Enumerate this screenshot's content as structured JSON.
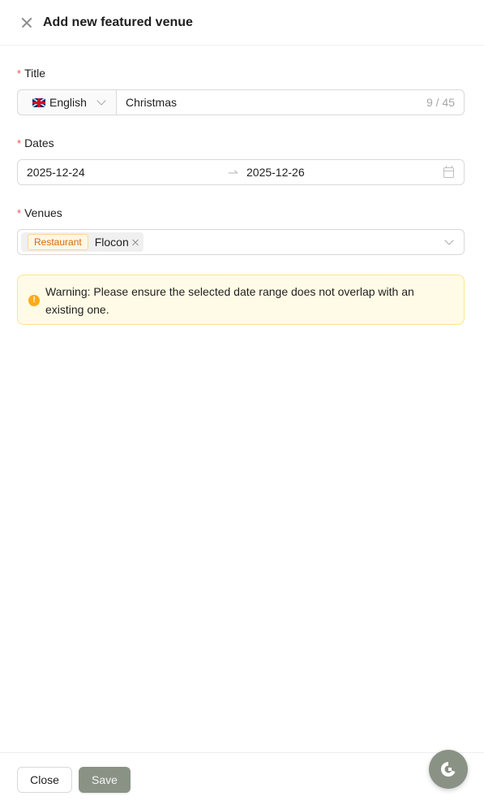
{
  "header": {
    "title": "Add new featured venue"
  },
  "form": {
    "title": {
      "label": "Title",
      "required_mark": "*",
      "language": "English",
      "value": "Christmas",
      "counter": "9 / 45"
    },
    "dates": {
      "label": "Dates",
      "required_mark": "*",
      "start": "2025-12-24",
      "end": "2025-12-26"
    },
    "venues": {
      "label": "Venues",
      "required_mark": "*",
      "selected": [
        {
          "category": "Restaurant",
          "name": "Flocon"
        }
      ]
    },
    "warning": {
      "icon": "!",
      "text": "Warning: Please ensure the selected date range does not overlap with an existing one."
    }
  },
  "footer": {
    "close_label": "Close",
    "save_label": "Save"
  },
  "colors": {
    "accent": "#8a9286",
    "required": "#ff4d4f",
    "warning_bg": "#fffbe6",
    "warning_icon": "#faad14",
    "category_tag": "#d46b08"
  },
  "icons": [
    "close-icon",
    "uk-flag-icon",
    "chevron-down-icon",
    "arrow-right-icon",
    "calendar-icon",
    "tag-close-icon",
    "warning-icon",
    "chat-icon"
  ]
}
